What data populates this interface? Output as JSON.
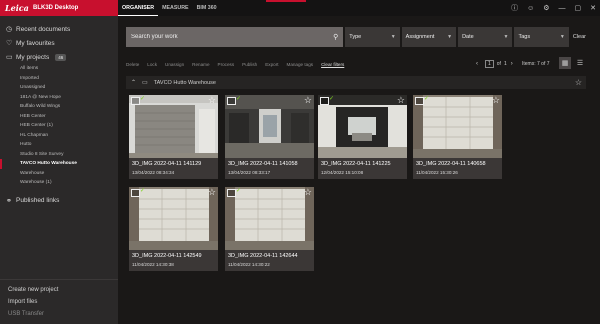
{
  "app": {
    "logo": "Leica",
    "title": "BLK3D Desktop"
  },
  "sidebar": {
    "recent": "Recent documents",
    "favourites": "My favourites",
    "projects": "My projects",
    "projects_badge": "46",
    "project_list": [
      "All items",
      "Imported",
      "Unassigned",
      "181A @ New Hope",
      "Buffalo Wild Wings",
      "HEB Center",
      "HEB Center (1)",
      "HL Chapman",
      "Hutto",
      "Studio 8 Site Survey",
      "TAVCO Hutto Warehouse",
      "Warehouse",
      "Warehouse (1)"
    ],
    "active_project": "TAVCO Hutto Warehouse",
    "published": "Published links",
    "create": "Create new project",
    "import": "Import files",
    "usb": "USB Transfer"
  },
  "tabs": [
    "ORGANISER",
    "MEASURE",
    "BIM 360"
  ],
  "filters": {
    "search_placeholder": "Search your work",
    "dropdowns": [
      "Type",
      "Assignment",
      "Date",
      "Tags"
    ],
    "clear": "Clear"
  },
  "actions": [
    "Delete",
    "Lock",
    "Unassign",
    "Rename",
    "Process",
    "Publish",
    "Export",
    "Manage tags"
  ],
  "clear_filters": "Clear filters",
  "pager": {
    "page": "1",
    "of_label": "of",
    "total": "1"
  },
  "items_count": "Items: 7 of 7",
  "breadcrumb": "TAVCO Hutto Warehouse",
  "cards": [
    {
      "title": "3D_IMG 2022-04-11 141129",
      "date": "13/04/2022 08:34:34",
      "scene": "door-closed"
    },
    {
      "title": "3D_IMG 2022-04-11 141058",
      "date": "13/04/2022 08:33:17",
      "scene": "interior"
    },
    {
      "title": "3D_IMG 2022-04-11 141225",
      "date": "12/04/2022 15:10:08",
      "scene": "open-door"
    },
    {
      "title": "3D_IMG 2022-04-11 140658",
      "date": "11/04/2022 15:30:26",
      "scene": "bay-door"
    },
    {
      "title": "3D_IMG 2022-04-11 142549",
      "date": "11/04/2022 14:30:38",
      "scene": "bay-door"
    },
    {
      "title": "3D_IMG 2022-04-11 142644",
      "date": "11/04/2022 14:30:22",
      "scene": "bay-door"
    }
  ],
  "colors": {
    "brand": "#c8102e",
    "check": "#7ed321"
  }
}
